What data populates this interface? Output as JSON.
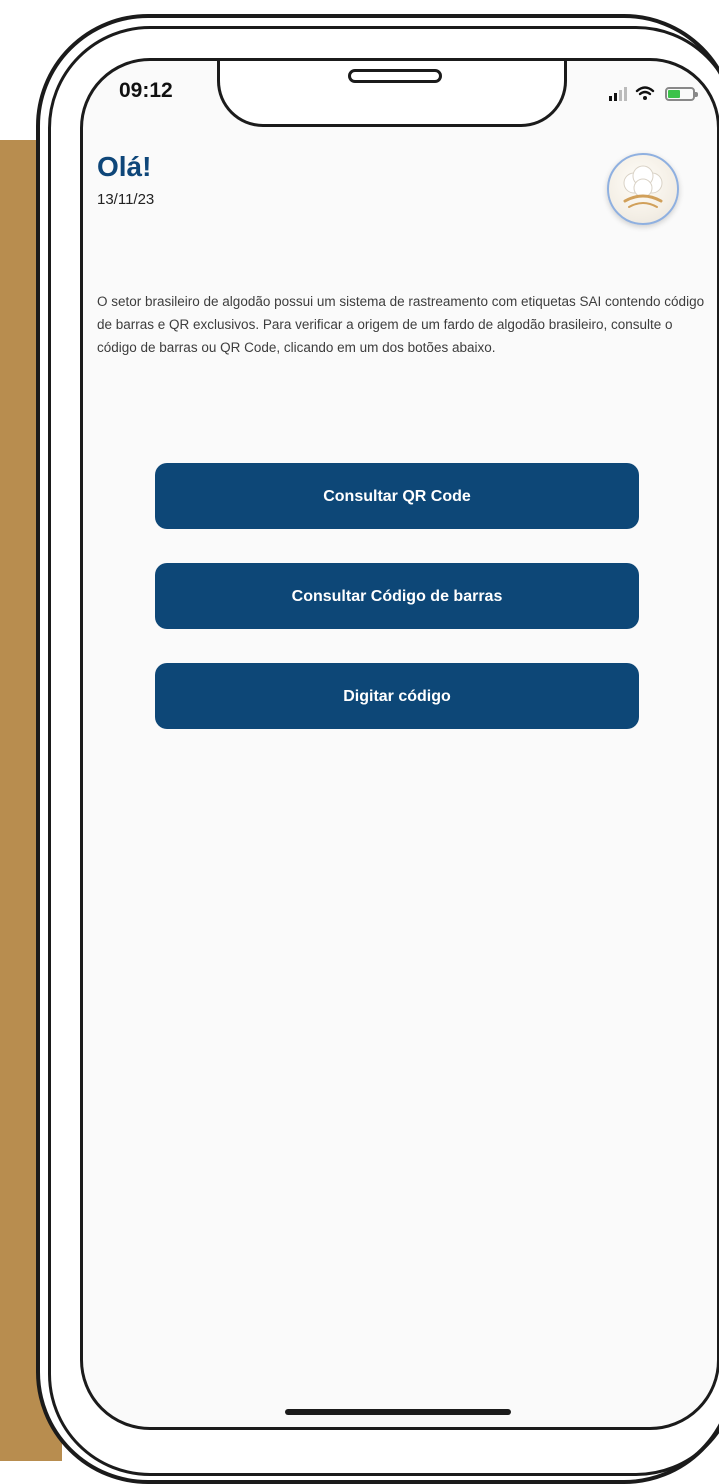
{
  "status_bar": {
    "time": "09:12",
    "icons": [
      "signal-icon",
      "wifi-icon",
      "battery-icon"
    ],
    "battery_color": "#3cc24a"
  },
  "header": {
    "greeting": "Olá!",
    "date": "13/11/23",
    "avatar_icon": "cotton-logo-icon"
  },
  "intro_text": "O setor brasileiro de algodão possui um sistema de rastreamento com etiquetas SAI contendo código de barras e QR exclusivos. Para verificar a origem de um fardo de algodão brasileiro, consulte o código de barras ou QR Code, clicando em um dos botões abaixo.",
  "actions": {
    "qr_label": "Consultar QR Code",
    "barcode_label": "Consultar Código de barras",
    "type_code_label": "Digitar código"
  },
  "colors": {
    "accent": "#0d4777",
    "greeting": "#0e4679",
    "side_panel": "#b88d4f"
  }
}
